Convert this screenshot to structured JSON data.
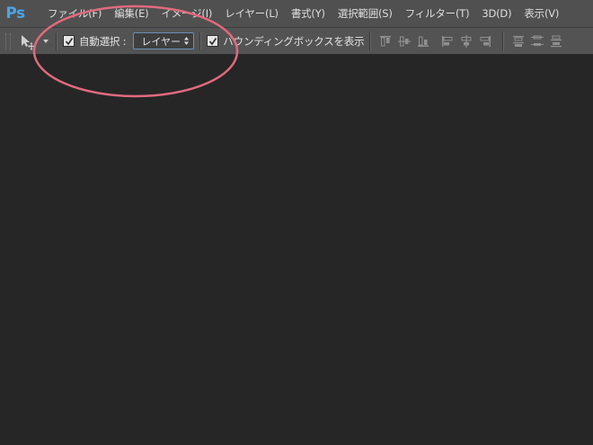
{
  "app": {
    "logo_text": "Ps"
  },
  "menu": {
    "items": [
      {
        "label": "ファイル(F)"
      },
      {
        "label": "編集(E)"
      },
      {
        "label": "イメージ(I)"
      },
      {
        "label": "レイヤー(L)"
      },
      {
        "label": "書式(Y)"
      },
      {
        "label": "選択範囲(S)"
      },
      {
        "label": "フィルター(T)"
      },
      {
        "label": "3D(D)"
      },
      {
        "label": "表示(V)"
      }
    ]
  },
  "options": {
    "tool_icon": "move-tool-icon",
    "auto_select_label": "自動選択 :",
    "auto_select_checked": true,
    "auto_select_target": "レイヤー",
    "bounding_box_label": "バウンディングボックスを表示",
    "bounding_box_checked": true,
    "align_icons": [
      "align-top-edges-icon",
      "align-vertical-centers-icon",
      "align-bottom-edges-icon",
      "align-left-edges-icon",
      "align-horizontal-centers-icon",
      "align-right-edges-icon"
    ],
    "distribute_icons": [
      "distribute-top-edges-icon",
      "distribute-vertical-centers-icon",
      "distribute-bottom-edges-icon"
    ]
  },
  "colors": {
    "menubar_bg": "#505050",
    "optionsbar_bg": "#535353",
    "canvas_bg": "#262626",
    "logo": "#4ba3e5",
    "annotation": "#e06a7e"
  }
}
